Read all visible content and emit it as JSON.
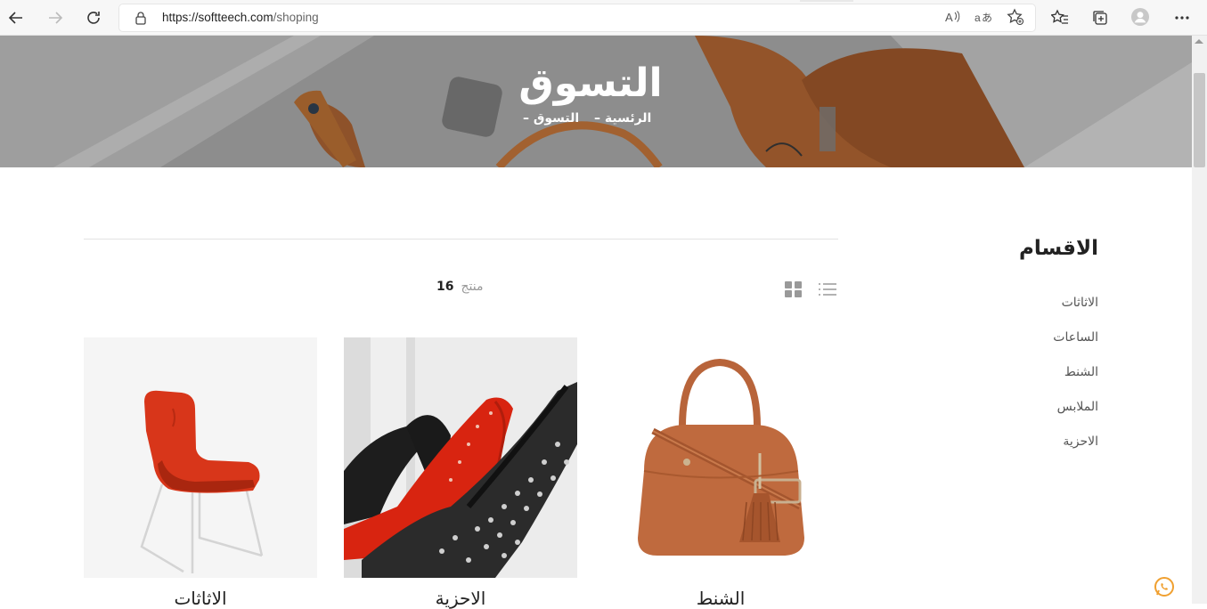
{
  "browser": {
    "url_host": "https://softteech.com",
    "url_path": "/shoping"
  },
  "hero": {
    "title": "التسوق",
    "breadcrumb": [
      {
        "label": "الرئسية",
        "sep": "–"
      },
      {
        "label": "التسوق",
        "sep": "–"
      }
    ]
  },
  "sidebar": {
    "title": "الاقسام",
    "items": [
      {
        "label": "الاثاثات"
      },
      {
        "label": "الساعات"
      },
      {
        "label": "الشنط"
      },
      {
        "label": "الملابس"
      },
      {
        "label": "الاحزية"
      }
    ]
  },
  "toolbar": {
    "count": "16",
    "count_label": "منتج"
  },
  "products": [
    {
      "name": "الاثاثات"
    },
    {
      "name": "الاحزية"
    },
    {
      "name": "الشنط"
    }
  ],
  "colors": {
    "accent": "#f0a030",
    "bag": "#b8643a",
    "chair": "#d8361a"
  }
}
